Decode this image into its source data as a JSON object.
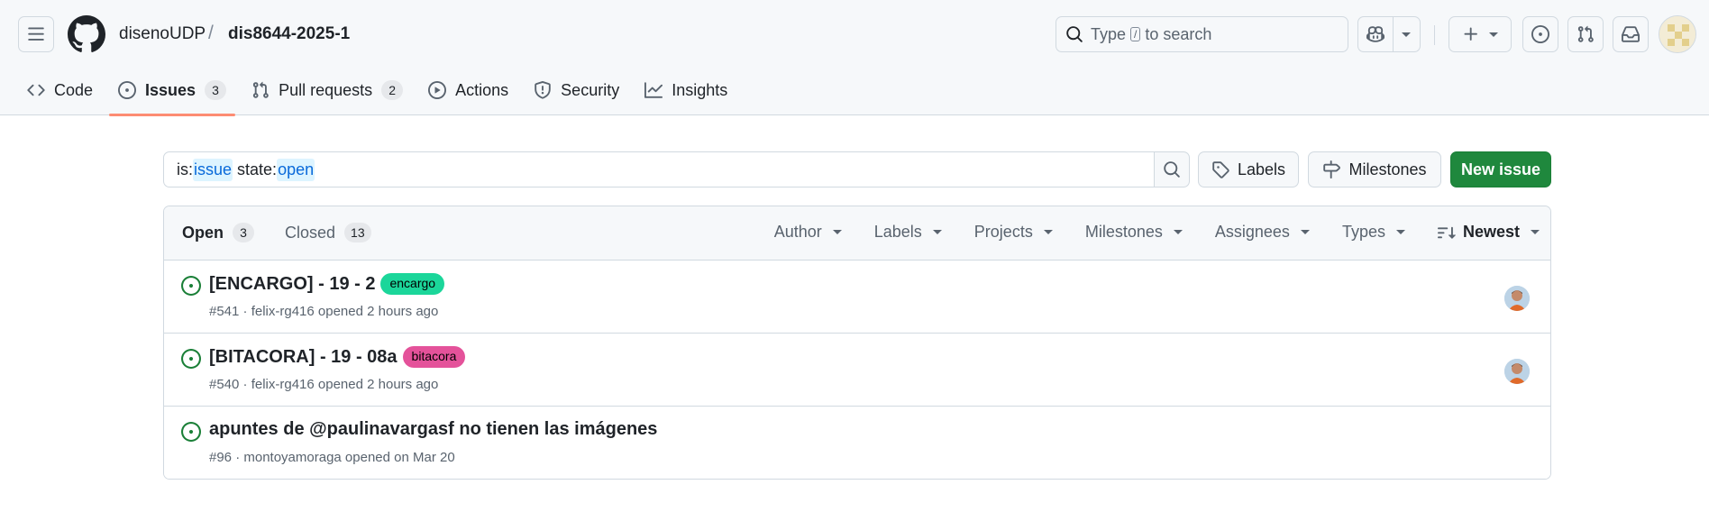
{
  "header": {
    "owner": "disenoUDP",
    "separator": "/",
    "repo": "dis8644-2025-1",
    "search": {
      "prefix": "Type",
      "key": "/",
      "suffix": "to search"
    },
    "icons": {
      "menu": "hamburger-icon",
      "logo": "github-mark-icon",
      "copilot": "copilot-icon",
      "plus": "plus-icon",
      "issues": "issue-opened-icon",
      "pull_requests": "git-pull-request-icon",
      "inbox": "inbox-icon"
    }
  },
  "repo_nav": [
    {
      "label": "Code",
      "icon": "code-icon"
    },
    {
      "label": "Issues",
      "icon": "issue-opened-icon",
      "count": "3",
      "selected": true
    },
    {
      "label": "Pull requests",
      "icon": "git-pull-request-icon",
      "count": "2"
    },
    {
      "label": "Actions",
      "icon": "play-icon"
    },
    {
      "label": "Security",
      "icon": "shield-icon"
    },
    {
      "label": "Insights",
      "icon": "graph-icon"
    }
  ],
  "filter": {
    "tokens": [
      {
        "key": "is:",
        "value": "issue"
      },
      {
        "key": " state:",
        "value": "open"
      }
    ],
    "labels_button": "Labels",
    "milestones_button": "Milestones",
    "new_issue_button": "New issue"
  },
  "list_header": {
    "open_label": "Open",
    "open_count": "3",
    "closed_label": "Closed",
    "closed_count": "13",
    "filters": [
      "Author",
      "Labels",
      "Projects",
      "Milestones",
      "Assignees",
      "Types"
    ],
    "sort": "Newest"
  },
  "issues": [
    {
      "title": "[ENCARGO] - 19 - 2",
      "label": "encargo",
      "label_color": "#1bd69a",
      "meta": "#541 · felix-rg416 opened 2 hours ago",
      "has_assignee": true
    },
    {
      "title": "[BITACORA] - 19 - 08a",
      "label": "bitacora",
      "label_color": "#e4529a",
      "meta": "#540 · felix-rg416 opened 2 hours ago",
      "has_assignee": true
    },
    {
      "title": "apuntes de @paulinavargasf no tienen las imágenes",
      "label": "",
      "label_color": "",
      "meta": "#96 · montoyamoraga opened on Mar 20",
      "has_assignee": false
    }
  ],
  "colors": {
    "open_icon": "#1a7f37",
    "new_issue_bg": "#1f883d",
    "accent_underline": "#fd8c73",
    "qualifier_blue": "#0969da"
  }
}
